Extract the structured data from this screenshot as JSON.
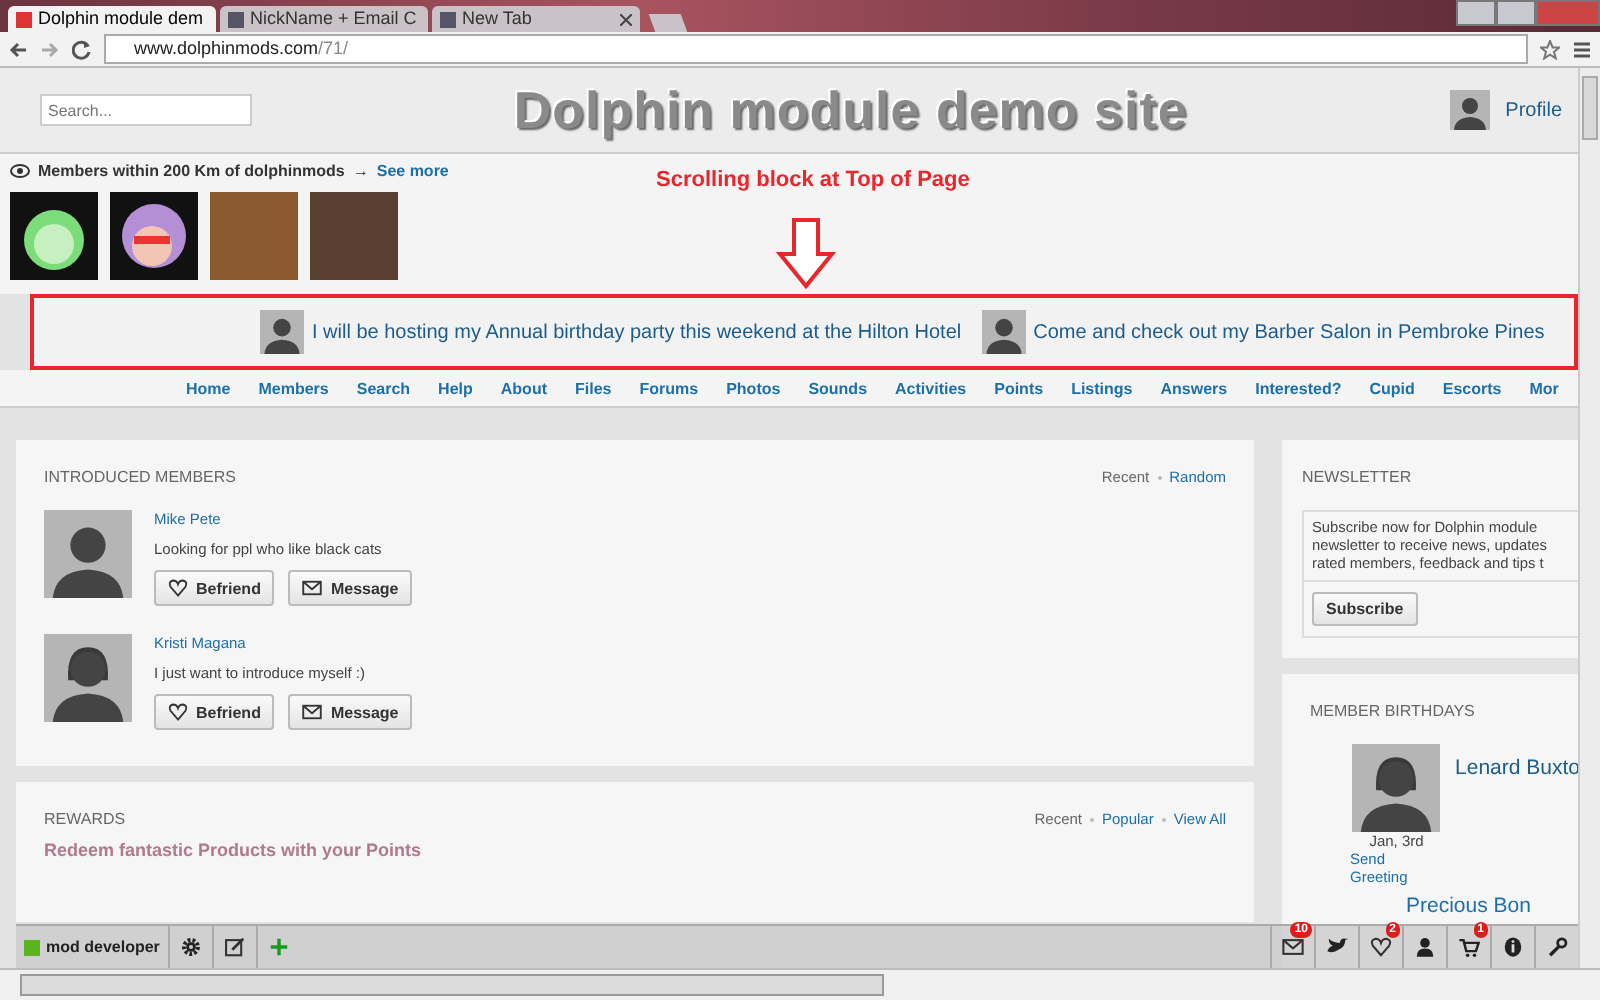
{
  "browser": {
    "tabs": [
      {
        "title": "Dolphin module dem",
        "selected": true
      },
      {
        "title": "NickName + Email C",
        "selected": false
      },
      {
        "title": "New Tab",
        "selected": false
      }
    ],
    "url_host": "www.dolphinmods.com",
    "url_path": "/71/"
  },
  "header": {
    "search_placeholder": "Search...",
    "site_title": "Dolphin module demo site",
    "profile_label": "Profile"
  },
  "nearby": {
    "label": "Members within 200 Km of dolphinmods",
    "arrow": "→",
    "link": "See more"
  },
  "annotation": {
    "text": "Scrolling block at Top of Page"
  },
  "scroller": {
    "items": [
      {
        "text": "I will be hosting my Annual birthday party this weekend at the Hilton Hotel"
      },
      {
        "text": "Come and check out my Barber Salon in Pembroke Pines"
      }
    ]
  },
  "nav": [
    "Home",
    "Members",
    "Search",
    "Help",
    "About",
    "Files",
    "Forums",
    "Photos",
    "Sounds",
    "Activities",
    "Points",
    "Listings",
    "Answers",
    "Interested?",
    "Cupid",
    "Escorts",
    "Mor"
  ],
  "introduced": {
    "title": "INTRODUCED MEMBERS",
    "filters": [
      {
        "label": "Recent",
        "selected": true
      },
      {
        "label": "Random",
        "selected": false
      }
    ],
    "members": [
      {
        "name": "Mike Pete",
        "kind": "male",
        "text": "Looking for ppl who like black cats",
        "buttons": [
          {
            "kind": "heart",
            "label": "Befriend"
          },
          {
            "kind": "mail",
            "label": "Message"
          }
        ]
      },
      {
        "name": "Kristi Magana",
        "kind": "female",
        "text": "I just want to introduce myself :)",
        "buttons": [
          {
            "kind": "heart",
            "label": "Befriend"
          },
          {
            "kind": "mail",
            "label": "Message"
          }
        ]
      }
    ]
  },
  "newsletter": {
    "title": "NEWSLETTER",
    "lines": [
      "Subscribe now for Dolphin module",
      "newsletter to receive news, updates",
      "rated members, feedback and tips t"
    ],
    "button": "Subscribe"
  },
  "birthdays": {
    "title": "MEMBER BIRTHDAYS",
    "name": "Lenard Buxto",
    "date": "Jan, 3rd",
    "action": "Send Greeting",
    "next_name": "Precious Bon"
  },
  "rewards": {
    "title": "REWARDS",
    "filters": [
      {
        "label": "Recent",
        "selected": true
      },
      {
        "label": "Popular",
        "selected": false
      },
      {
        "label": "View All",
        "selected": false
      }
    ],
    "text": "Redeem fantastic Products with your Points"
  },
  "toolbar": {
    "user": "mod developer",
    "left_tools": [
      {
        "kind": "gear"
      },
      {
        "kind": "edit"
      },
      {
        "kind": "plus"
      }
    ],
    "right_tools": [
      {
        "kind": "mail",
        "badge": "10"
      },
      {
        "kind": "bird"
      },
      {
        "kind": "heart",
        "badge": "2"
      },
      {
        "kind": "person"
      },
      {
        "kind": "cart",
        "badge": "1"
      },
      {
        "kind": "info"
      },
      {
        "kind": "wrench"
      }
    ]
  }
}
